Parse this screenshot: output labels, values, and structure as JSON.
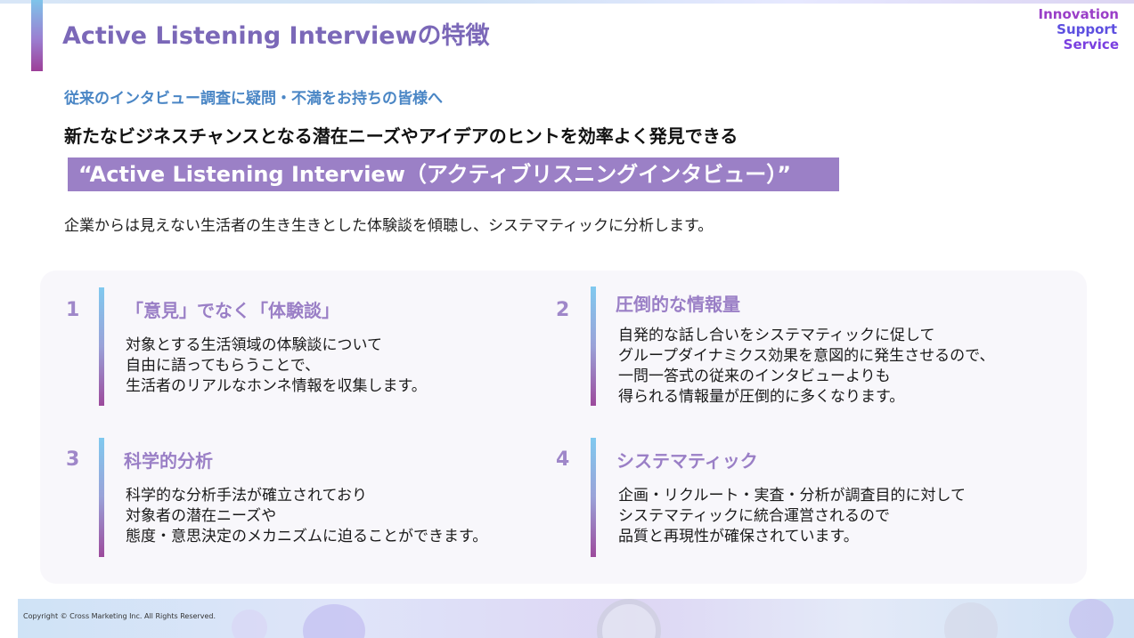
{
  "header": {
    "title": "Active Listening Interviewの特徴",
    "brand_line1": "Innovation",
    "brand_line2": "Support",
    "brand_line3": "Service"
  },
  "intro": {
    "question": "従来のインタビュー調査に疑問・不満をお持ちの皆様へ",
    "lead": "新たなビジネスチャンスとなる潜在ニーズやアイデアのヒントを効率よく発見できる",
    "tagline": "“Active Listening Interview（アクティブリスニングインタビュー）”",
    "description": "企業からは見えない生活者の生き生きとした体験談を傾聴し、システマティックに分析します。"
  },
  "features": [
    {
      "number": "1",
      "title": "「意見」でなく「体験談」",
      "lines": [
        "対象とする生活領域の体験談について",
        "自由に語ってもらうことで、",
        "生活者のリアルなホンネ情報を収集します。"
      ]
    },
    {
      "number": "2",
      "title": "圧倒的な情報量",
      "lines": [
        "自発的な話し合いをシステマティックに促して",
        "グループダイナミクス効果を意図的に発生させるので、",
        "一問一答式の従来のインタビューよりも",
        "得られる情報量が圧倒的に多くなります。"
      ]
    },
    {
      "number": "3",
      "title": "科学的分析",
      "lines": [
        "科学的な分析手法が確立されており",
        "対象者の潜在ニーズや",
        "態度・意思決定のメカニズムに迫ることができます。"
      ]
    },
    {
      "number": "4",
      "title": "システマティック",
      "lines": [
        "企画・リクルート・実査・分析が調査目的に対して",
        "システマティックに統合運営されるので",
        "品質と再現性が確保されています。"
      ]
    }
  ],
  "footer": {
    "copyright": "Copyright © Cross Marketing Inc. All Rights Reserved."
  },
  "colors": {
    "title": "#7b68b8",
    "accent_purple": "#9b80c6",
    "question_blue": "#4a86c5",
    "brand": "#8a3fd0"
  }
}
